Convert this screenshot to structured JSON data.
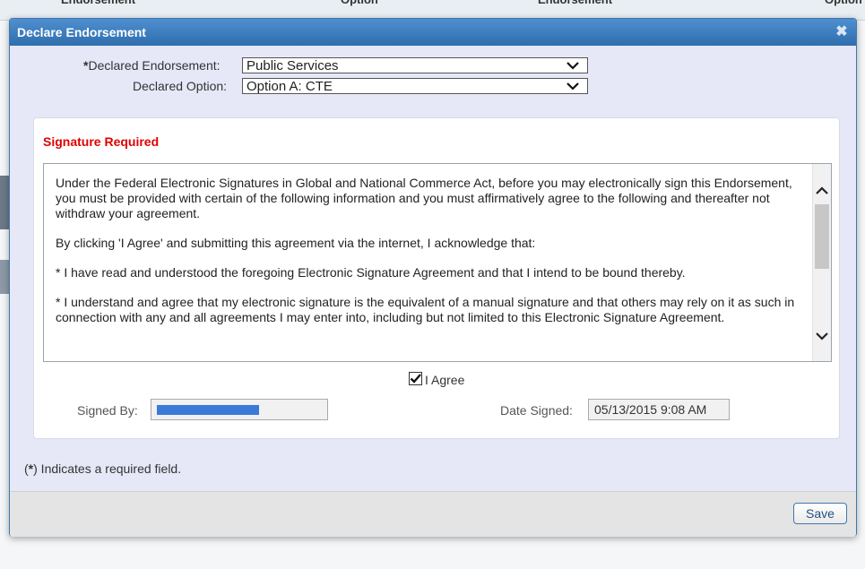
{
  "background": {
    "columns": [
      "Endorsement",
      "Option",
      "Endorsement",
      "Option"
    ]
  },
  "dialog": {
    "title": "Declare Endorsement",
    "close_icon": "close-icon"
  },
  "form": {
    "required_mark": "*",
    "declared_endorsement_label": "Declared Endorsement:",
    "declared_endorsement_value": "Public Services",
    "declared_option_label": "Declared Option:",
    "declared_option_value": "Option A: CTE"
  },
  "signature": {
    "heading": "Signature Required",
    "agreement_paragraphs": [
      "Under the Federal Electronic Signatures in Global and National Commerce Act, before you may electronically sign this Endorsement, you must be provided with certain of the following information and you must affirmatively agree to the following and thereafter not withdraw your agreement.",
      "By clicking 'I Agree' and submitting this agreement via the internet, I acknowledge that:",
      "* I have read and understood the foregoing Electronic Signature Agreement and that I intend to be bound thereby.",
      "* I understand and agree that my electronic signature is the equivalent of a manual signature and that others may rely on it as such in connection with any and all agreements I may enter into, including but not limited to this Electronic Signature Agreement."
    ],
    "agree_label": "I Agree",
    "agree_checked": true,
    "signed_by_label": "Signed By:",
    "date_signed_label": "Date Signed:",
    "date_signed_value": "05/13/2015 9:08 AM"
  },
  "footer": {
    "required_note_open": "(",
    "required_note_star": "*",
    "required_note_text": ") Indicates a required field.",
    "save_label": "Save"
  },
  "colors": {
    "title_bar": "#2f6ead",
    "required_heading": "#e00000",
    "redaction": "#3b7ad8"
  }
}
